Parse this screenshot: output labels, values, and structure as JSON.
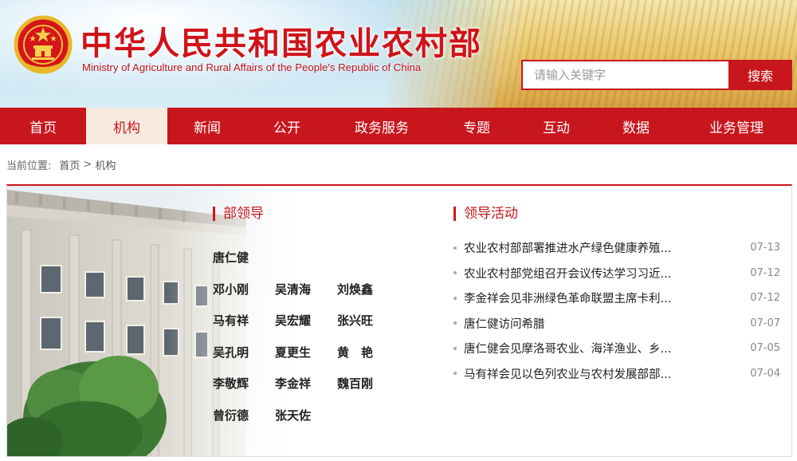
{
  "header": {
    "title": "中华人民共和国农业农村部",
    "subtitle": "Ministry of Agriculture and Rural Affairs of the People's Republic of China",
    "emblem_icon": "national-emblem-icon"
  },
  "search": {
    "placeholder": "请输入关键字",
    "button_label": "搜索"
  },
  "nav": {
    "items": [
      {
        "label": "首页"
      },
      {
        "label": "机构",
        "active": true
      },
      {
        "label": "新闻"
      },
      {
        "label": "公开"
      },
      {
        "label": "政务服务"
      },
      {
        "label": "专题"
      },
      {
        "label": "互动"
      },
      {
        "label": "数据"
      },
      {
        "label": "业务管理"
      }
    ]
  },
  "breadcrumb": {
    "label": "当前位置:",
    "items": [
      "首页",
      "机构"
    ],
    "separator": ">"
  },
  "leaders_section": {
    "title": "部领导",
    "rows": [
      [
        "唐仁健"
      ],
      [
        "邓小刚",
        "吴清海",
        "刘焕鑫"
      ],
      [
        "马有祥",
        "吴宏耀",
        "张兴旺"
      ],
      [
        "吴孔明",
        "夏更生",
        "黄　艳"
      ],
      [
        "李敬辉",
        "李金祥",
        "魏百刚"
      ],
      [
        "曾衍德",
        "张天佐"
      ]
    ]
  },
  "activities_section": {
    "title": "领导活动",
    "items": [
      {
        "title": "农业农村部部署推进水产绿色健康养殖...",
        "date": "07-13"
      },
      {
        "title": "农业农村部党组召开会议传达学习习近...",
        "date": "07-12"
      },
      {
        "title": "李金祥会见非洲绿色革命联盟主席卡利...",
        "date": "07-12"
      },
      {
        "title": "唐仁健访问希腊",
        "date": "07-07"
      },
      {
        "title": "唐仁健会见摩洛哥农业、海洋渔业、乡...",
        "date": "07-05"
      },
      {
        "title": "马有祥会见以色列农业与农村发展部部...",
        "date": "07-04"
      }
    ]
  },
  "colors": {
    "brand_red": "#c8161d",
    "active_tab_bg": "#f7ebe0"
  }
}
